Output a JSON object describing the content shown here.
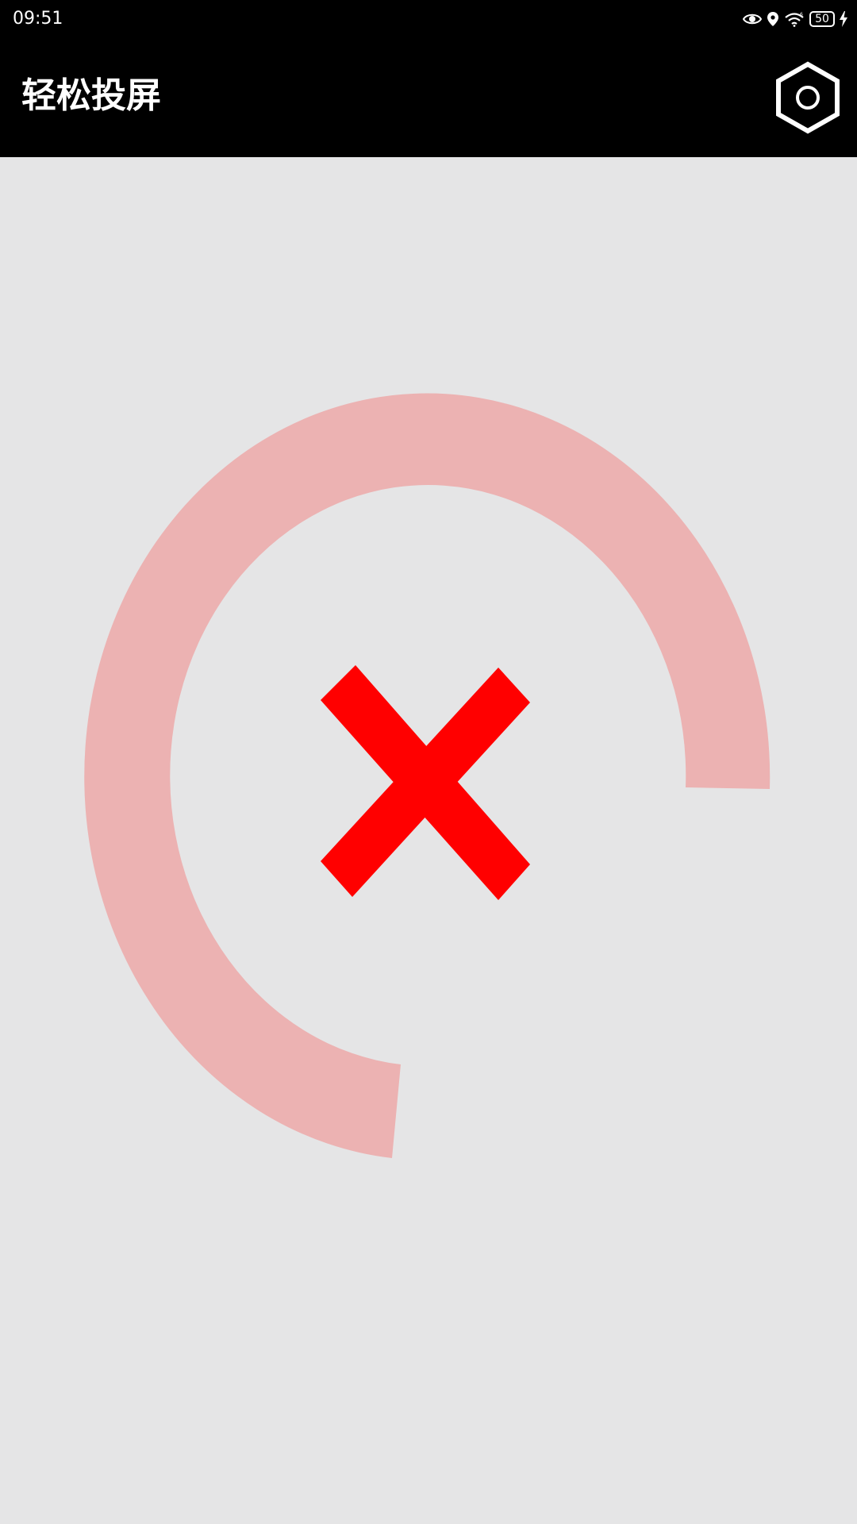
{
  "status_bar": {
    "time": "09:51",
    "battery_level": "50",
    "icons": [
      "eye-icon",
      "location-icon",
      "wifi-icon",
      "battery-icon",
      "charging-icon"
    ]
  },
  "app_bar": {
    "title": "轻松投屏",
    "settings_icon": "hexagon-settings-icon"
  },
  "main": {
    "status_icon": "error-x-icon",
    "spinner": "loading-arc"
  },
  "colors": {
    "status_bar_bg": "#000000",
    "app_bar_bg": "#000000",
    "content_bg": "#e5e5e6",
    "arc": "#ecb2b2",
    "error_x": "#ff0000"
  }
}
